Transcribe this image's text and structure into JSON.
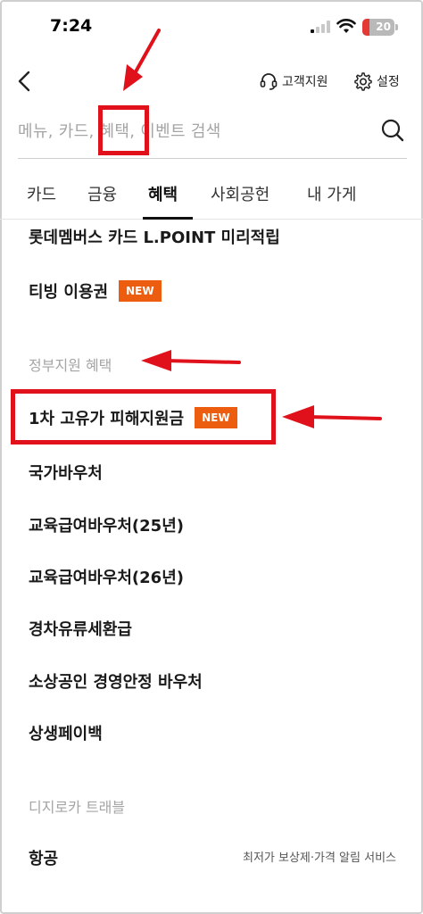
{
  "status_bar": {
    "time": "7:24",
    "battery": "20"
  },
  "header": {
    "back_icon": "chevron-left-icon",
    "support_label": "고객지원",
    "settings_label": "설정"
  },
  "search": {
    "placeholder": "메뉴, 카드, 혜택, 이벤트 검색"
  },
  "tabs": [
    {
      "label": "카드",
      "active": false
    },
    {
      "label": "금융",
      "active": false
    },
    {
      "label": "혜택",
      "active": true
    },
    {
      "label": "사회공헌",
      "active": false
    },
    {
      "label": "내 가게",
      "active": false
    }
  ],
  "list": {
    "item_lpoint": "롯데멤버스 카드 L.POINT 미리적립",
    "item_tving": "티빙 이용권",
    "new_badge": "NEW",
    "section_gov": "정부지원 혜택",
    "item_support": "1차 고유가 피해지원금",
    "item_voucher": "국가바우처",
    "item_edu25": "교육급여바우처(25년)",
    "item_edu26": "교육급여바우처(26년)",
    "item_fuel": "경차유류세환급",
    "item_smallbiz": "소상공인 경영안정 바우처",
    "item_payback": "상생페이백",
    "section_travel": "디지로카 트래블",
    "item_air": "항공",
    "item_air_sub": "최저가 보상제·가격 알림 서비스"
  },
  "colors": {
    "badge": "#ec5d0f",
    "annotation": "#e0111b"
  }
}
